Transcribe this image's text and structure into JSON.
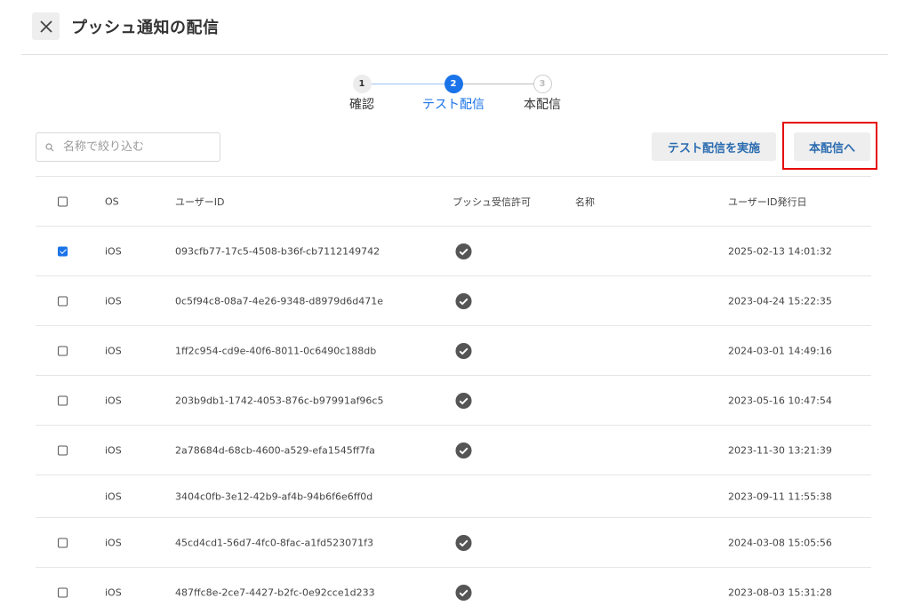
{
  "header": {
    "title": "プッシュ通知の配信",
    "close_icon": "close-icon"
  },
  "stepper": {
    "steps": [
      {
        "number": "1",
        "label": "確認",
        "state": "done"
      },
      {
        "number": "2",
        "label": "テスト配信",
        "state": "active"
      },
      {
        "number": "3",
        "label": "本配信",
        "state": "pending"
      }
    ]
  },
  "search": {
    "placeholder": "名称で絞り込む",
    "value": ""
  },
  "actions": {
    "test_send_label": "テスト配信を実施",
    "main_send_label": "本配信へ"
  },
  "table": {
    "columns": [
      "OS",
      "ユーザーID",
      "プッシュ受信許可",
      "名称",
      "ユーザーID発行日"
    ],
    "rows": [
      {
        "checked": true,
        "has_checkbox": true,
        "os": "iOS",
        "user_id": "093cfb77-17c5-4508-b36f-cb7112149742",
        "push_allowed": true,
        "name": "",
        "issued": "2025-02-13 14:01:32"
      },
      {
        "checked": false,
        "has_checkbox": true,
        "os": "iOS",
        "user_id": "0c5f94c8-08a7-4e26-9348-d8979d6d471e",
        "push_allowed": true,
        "name": "",
        "issued": "2023-04-24 15:22:35"
      },
      {
        "checked": false,
        "has_checkbox": true,
        "os": "iOS",
        "user_id": "1ff2c954-cd9e-40f6-8011-0c6490c188db",
        "push_allowed": true,
        "name": "",
        "issued": "2024-03-01 14:49:16"
      },
      {
        "checked": false,
        "has_checkbox": true,
        "os": "iOS",
        "user_id": "203b9db1-1742-4053-876c-b97991af96c5",
        "push_allowed": true,
        "name": "",
        "issued": "2023-05-16 10:47:54"
      },
      {
        "checked": false,
        "has_checkbox": true,
        "os": "iOS",
        "user_id": "2a78684d-68cb-4600-a529-efa1545ff7fa",
        "push_allowed": true,
        "name": "",
        "issued": "2023-11-30 13:21:39"
      },
      {
        "checked": false,
        "has_checkbox": false,
        "os": "iOS",
        "user_id": "3404c0fb-3e12-42b9-af4b-94b6f6e6ff0d",
        "push_allowed": false,
        "name": "",
        "issued": "2023-09-11 11:55:38"
      },
      {
        "checked": false,
        "has_checkbox": true,
        "os": "iOS",
        "user_id": "45cd4cd1-56d7-4fc0-8fac-a1fd523071f3",
        "push_allowed": true,
        "name": "",
        "issued": "2024-03-08 15:05:56"
      },
      {
        "checked": false,
        "has_checkbox": true,
        "os": "iOS",
        "user_id": "487ffc8e-2ce7-4427-b2fc-0e92cce1d233",
        "push_allowed": true,
        "name": "",
        "issued": "2023-08-03 15:31:28"
      }
    ]
  },
  "colors": {
    "accent": "#1a73e8",
    "button_text": "#2b6cb0",
    "highlight": "#e60000",
    "check_icon": "#555555"
  }
}
